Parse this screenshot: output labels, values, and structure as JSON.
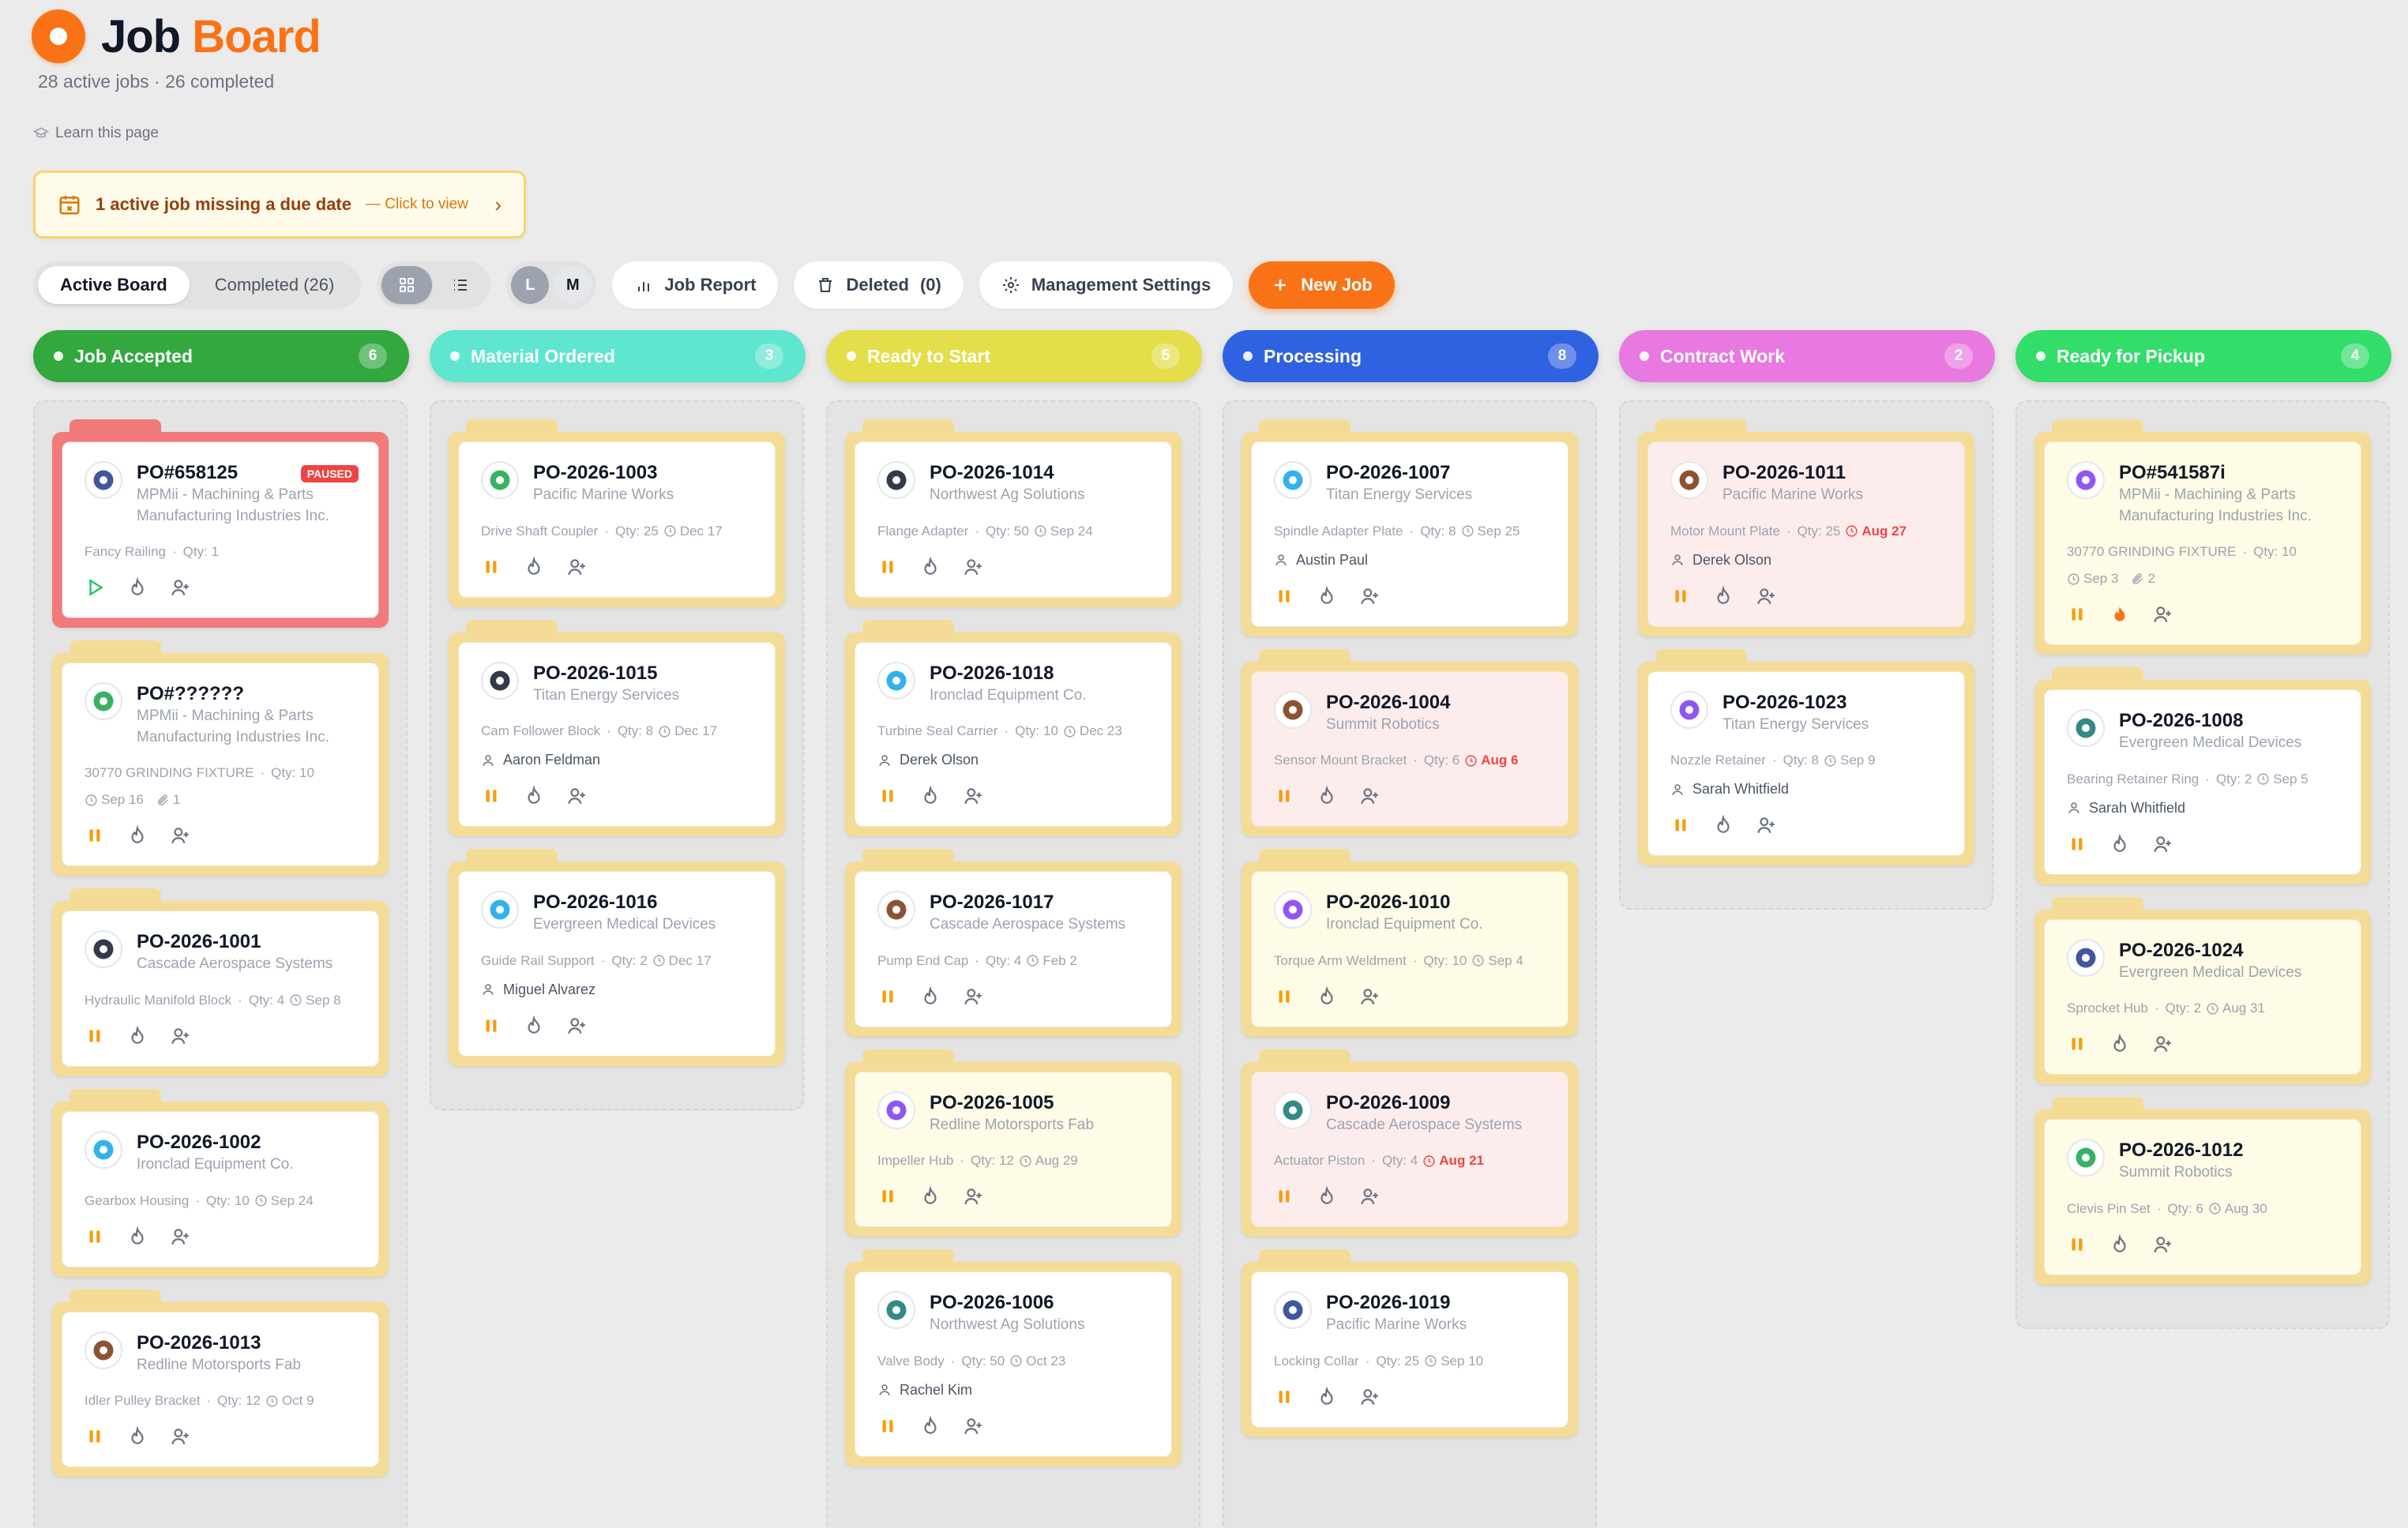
{
  "header": {
    "title_part1": "Job",
    "title_part2": "Board",
    "subtitle": "28 active jobs · 26 completed",
    "learn_link": "Learn this page"
  },
  "alert": {
    "text": "1 active job missing a due date",
    "link": "— Click to view"
  },
  "toolbar": {
    "active_board": "Active Board",
    "completed": "Completed (26)",
    "avatar_l": "L",
    "avatar_m": "M",
    "job_report": "Job Report",
    "deleted": "Deleted",
    "deleted_count": "(0)",
    "management_settings": "Management  Settings",
    "new_job": "New Job"
  },
  "columns": [
    {
      "title": "Job Accepted",
      "count": "6",
      "color": "#32a83f",
      "jobs": [
        {
          "po": "PO#658125",
          "customer": "MPMii - Machining & Parts Manufacturing Industries Inc.",
          "part": "Fancy Railing",
          "qty": "Qty: 1",
          "due": "",
          "assignee": "",
          "style": "red",
          "badge": "PAUSED",
          "status_icon": "play-icon"
        },
        {
          "po": "PO#??????",
          "customer": "MPMii - Machining & Parts Manufacturing Industries Inc.",
          "part": "30770 GRINDING FIXTURE",
          "qty": "Qty: 10",
          "due": "Sep 16",
          "attach": "1",
          "assignee": "",
          "style": "white"
        },
        {
          "po": "PO-2026-1001",
          "customer": "Cascade Aerospace Systems",
          "part": "Hydraulic Manifold Block",
          "qty": "Qty: 4",
          "due": "Sep 8",
          "assignee": "",
          "style": "white"
        },
        {
          "po": "PO-2026-1002",
          "customer": "Ironclad Equipment Co.",
          "part": "Gearbox Housing",
          "qty": "Qty: 10",
          "due": "Sep 24",
          "assignee": "",
          "style": "white"
        },
        {
          "po": "PO-2026-1013",
          "customer": "Redline Motorsports Fab",
          "part": "Idler Pulley Bracket",
          "qty": "Qty: 12",
          "due": "Oct 9",
          "assignee": "",
          "style": "white"
        }
      ]
    },
    {
      "title": "Material Ordered",
      "count": "3",
      "color": "#5ee6cf",
      "jobs": [
        {
          "po": "PO-2026-1003",
          "customer": "Pacific Marine Works",
          "part": "Drive Shaft Coupler",
          "qty": "Qty: 25",
          "due": "Dec 17",
          "assignee": "",
          "style": "white"
        },
        {
          "po": "PO-2026-1015",
          "customer": "Titan Energy Services",
          "part": "Cam Follower Block",
          "qty": "Qty: 8",
          "due": "Dec 17",
          "assignee": "Aaron Feldman",
          "style": "white"
        },
        {
          "po": "PO-2026-1016",
          "customer": "Evergreen Medical Devices",
          "part": "Guide Rail Support",
          "qty": "Qty: 2",
          "due": "Dec 17",
          "assignee": "Miguel Alvarez",
          "style": "white"
        }
      ]
    },
    {
      "title": "Ready to Start",
      "count": "5",
      "color": "#e3de4a",
      "jobs": [
        {
          "po": "PO-2026-1014",
          "customer": "Northwest Ag Solutions",
          "part": "Flange Adapter",
          "qty": "Qty: 50",
          "due": "Sep 24",
          "assignee": "",
          "style": "white"
        },
        {
          "po": "PO-2026-1018",
          "customer": "Ironclad Equipment Co.",
          "part": "Turbine Seal Carrier",
          "qty": "Qty: 10",
          "due": "Dec 23",
          "assignee": "Derek Olson",
          "style": "white"
        },
        {
          "po": "PO-2026-1017",
          "customer": "Cascade Aerospace Systems",
          "part": "Pump End Cap",
          "qty": "Qty: 4",
          "due": "Feb 2",
          "assignee": "",
          "style": "white"
        },
        {
          "po": "PO-2026-1005",
          "customer": "Redline Motorsports Fab",
          "part": "Impeller Hub",
          "qty": "Qty: 12",
          "due": "Aug 29",
          "assignee": "",
          "style": "yellow"
        },
        {
          "po": "PO-2026-1006",
          "customer": "Northwest Ag Solutions",
          "part": "Valve Body",
          "qty": "Qty: 50",
          "due": "Oct 23",
          "assignee": "Rachel Kim",
          "style": "white"
        }
      ]
    },
    {
      "title": "Processing",
      "count": "8",
      "color": "#2f62e0",
      "jobs": [
        {
          "po": "PO-2026-1007",
          "customer": "Titan Energy Services",
          "part": "Spindle Adapter Plate",
          "qty": "Qty: 8",
          "due": "Sep 25",
          "assignee": "Austin Paul",
          "style": "white"
        },
        {
          "po": "PO-2026-1004",
          "customer": "Summit Robotics",
          "part": "Sensor Mount Bracket",
          "qty": "Qty: 6",
          "due": "Aug 6",
          "overdue": true,
          "assignee": "",
          "style": "pink"
        },
        {
          "po": "PO-2026-1010",
          "customer": "Ironclad Equipment Co.",
          "part": "Torque Arm Weldment",
          "qty": "Qty: 10",
          "due": "Sep 4",
          "assignee": "",
          "style": "yellow"
        },
        {
          "po": "PO-2026-1009",
          "customer": "Cascade Aerospace Systems",
          "part": "Actuator Piston",
          "qty": "Qty: 4",
          "due": "Aug 21",
          "overdue": true,
          "assignee": "",
          "style": "pink"
        },
        {
          "po": "PO-2026-1019",
          "customer": "Pacific Marine Works",
          "part": "Locking Collar",
          "qty": "Qty: 25",
          "due": "Sep 10",
          "assignee": "",
          "style": "white"
        }
      ]
    },
    {
      "title": "Contract Work",
      "count": "2",
      "color": "#e879e0",
      "jobs": [
        {
          "po": "PO-2026-1011",
          "customer": "Pacific Marine Works",
          "part": "Motor Mount Plate",
          "qty": "Qty: 25",
          "due": "Aug 27",
          "overdue": true,
          "assignee": "Derek Olson",
          "style": "pink"
        },
        {
          "po": "PO-2026-1023",
          "customer": "Titan Energy Services",
          "part": "Nozzle Retainer",
          "qty": "Qty: 8",
          "due": "Sep 9",
          "assignee": "Sarah Whitfield",
          "style": "white"
        }
      ]
    },
    {
      "title": "Ready for Pickup",
      "count": "4",
      "color": "#33dd6a",
      "jobs": [
        {
          "po": "PO#541587i",
          "customer": "MPMii - Machining & Parts Manufacturing Industries Inc.",
          "part": "30770 GRINDING FIXTURE",
          "qty": "Qty: 10",
          "due": "Sep 3",
          "attach": "2",
          "assignee": "",
          "style": "yellow",
          "hot": true
        },
        {
          "po": "PO-2026-1008",
          "customer": "Evergreen Medical Devices",
          "part": "Bearing Retainer Ring",
          "qty": "Qty: 2",
          "due": "Sep 5",
          "assignee": "Sarah Whitfield",
          "style": "white"
        },
        {
          "po": "PO-2026-1024",
          "customer": "Evergreen Medical Devices",
          "part": "Sprocket Hub",
          "qty": "Qty: 2",
          "due": "Aug 31",
          "assignee": "",
          "style": "yellow"
        },
        {
          "po": "PO-2026-1012",
          "customer": "Summit Robotics",
          "part": "Clevis Pin Set",
          "qty": "Qty: 6",
          "due": "Aug 30",
          "assignee": "",
          "style": "yellow"
        }
      ]
    }
  ]
}
